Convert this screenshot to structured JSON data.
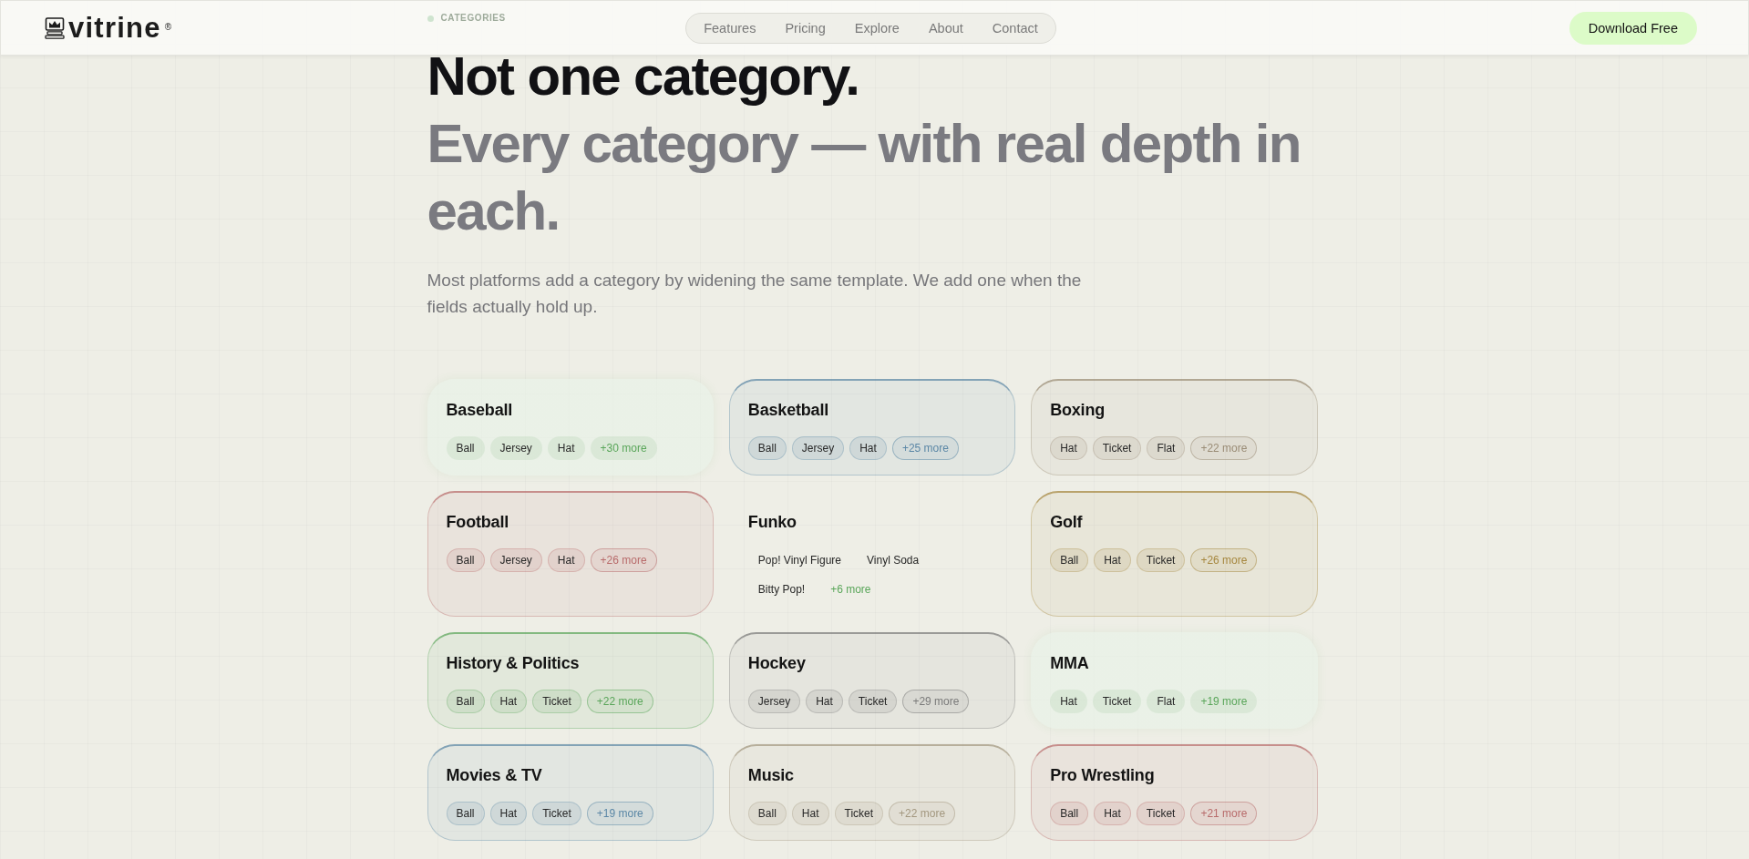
{
  "brand": {
    "name": "vitrine",
    "mark": "®"
  },
  "nav": [
    "Features",
    "Pricing",
    "Explore",
    "About",
    "Contact"
  ],
  "cta": "Download Free",
  "eyebrow": "CATEGORIES",
  "heading": {
    "lead": "Not one category.",
    "rest": "Every category — with real depth in each."
  },
  "intro": "Most platforms add a category by widening the same template. We add one when the fields actually hold up.",
  "categories": [
    {
      "name": "Baseball",
      "kind": "soft",
      "color": "#5aa65a",
      "fields": [
        "Ball",
        "Jersey",
        "Hat"
      ],
      "more": "+30 more"
    },
    {
      "name": "Basketball",
      "kind": "bordered",
      "color": "#5b87a6",
      "fields": [
        "Ball",
        "Jersey",
        "Hat"
      ],
      "more": "+25 more"
    },
    {
      "name": "Boxing",
      "kind": "bordered",
      "color": "#9a8c76",
      "fields": [
        "Hat",
        "Ticket",
        "Flat"
      ],
      "more": "+22 more"
    },
    {
      "name": "Football",
      "kind": "bordered",
      "color": "#b86b6b",
      "fields": [
        "Ball",
        "Jersey",
        "Hat"
      ],
      "more": "+26 more"
    },
    {
      "name": "Funko",
      "kind": "plain",
      "color": "#5aa65a",
      "fields": [
        "Pop! Vinyl Figure",
        "Vinyl Soda",
        "Bitty Pop!"
      ],
      "more": "+6 more"
    },
    {
      "name": "Golf",
      "kind": "bordered",
      "color": "#a6873f",
      "fields": [
        "Ball",
        "Hat",
        "Ticket"
      ],
      "more": "+26 more"
    },
    {
      "name": "History & Politics",
      "kind": "bordered",
      "color": "#5aa65a",
      "fields": [
        "Ball",
        "Hat",
        "Ticket"
      ],
      "more": "+22 more"
    },
    {
      "name": "Hockey",
      "kind": "bordered",
      "color": "#7a7a7a",
      "fields": [
        "Jersey",
        "Hat",
        "Ticket"
      ],
      "more": "+29 more"
    },
    {
      "name": "MMA",
      "kind": "soft",
      "color": "#5aa65a",
      "fields": [
        "Hat",
        "Ticket",
        "Flat"
      ],
      "more": "+19 more"
    },
    {
      "name": "Movies & TV",
      "kind": "bordered",
      "color": "#5b87a6",
      "fields": [
        "Ball",
        "Hat",
        "Ticket"
      ],
      "more": "+19 more"
    },
    {
      "name": "Music",
      "kind": "bordered",
      "color": "#a3977f",
      "fields": [
        "Ball",
        "Hat",
        "Ticket"
      ],
      "more": "+22 more"
    },
    {
      "name": "Pro Wrestling",
      "kind": "bordered",
      "color": "#b86b6b",
      "fields": [
        "Ball",
        "Hat",
        "Ticket"
      ],
      "more": "+21 more"
    }
  ]
}
